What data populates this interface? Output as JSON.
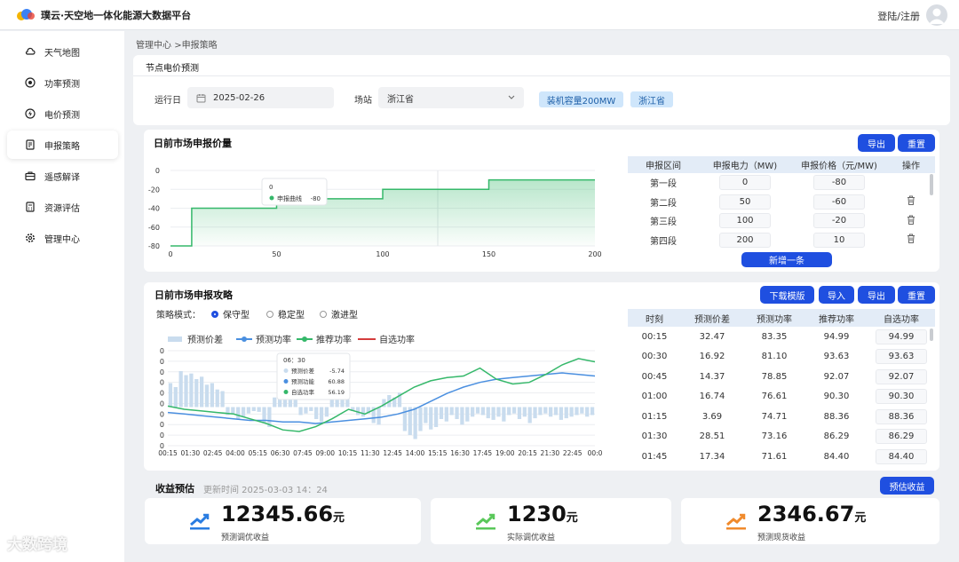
{
  "app": {
    "title": "璞云·天空地一体化能源大数据平台",
    "login": "登陆/注册"
  },
  "sidebar": {
    "items": [
      {
        "label": "天气地图",
        "icon": "cloud-sun-icon"
      },
      {
        "label": "功率预测",
        "icon": "target-icon"
      },
      {
        "label": "电价预测",
        "icon": "lightning-icon"
      },
      {
        "label": "申报策略",
        "icon": "document-icon"
      },
      {
        "label": "遥感解译",
        "icon": "briefcase-icon"
      },
      {
        "label": "资源评估",
        "icon": "calculator-icon"
      },
      {
        "label": "管理中心",
        "icon": "gear-icon"
      }
    ],
    "active": "申报策略"
  },
  "breadcrumb": {
    "root": "管理中心",
    "current": ">申报策略"
  },
  "section_title": "节点电价预测",
  "filters": {
    "date_label": "运行日",
    "date_value": "2025-02-26",
    "station_label": "场站",
    "station_value": "浙江省",
    "tags": [
      "装机容量200MW",
      "浙江省"
    ]
  },
  "bid_panel": {
    "title": "日前市场申报价量",
    "export": "导出",
    "reset": "重置",
    "columns": [
      "申报区间",
      "申报电力（MW)",
      "申报价格（元/MW)",
      "操作"
    ],
    "rows": [
      {
        "seg": "第一段",
        "power": "0",
        "price": "-80"
      },
      {
        "seg": "第二段",
        "power": "50",
        "price": "-60"
      },
      {
        "seg": "第三段",
        "power": "100",
        "price": "-20"
      },
      {
        "seg": "第四段",
        "power": "200",
        "price": "10"
      }
    ],
    "add_button": "新增一条",
    "tooltip": {
      "x": "0",
      "name": "申报曲线",
      "value": "-80"
    }
  },
  "strategy_panel": {
    "title": "日前市场申报攻略",
    "download": "下载模版",
    "import": "导入",
    "export": "导出",
    "reset": "重置",
    "mode_label": "策略模式：",
    "modes": [
      "保守型",
      "稳定型",
      "激进型"
    ],
    "selected_mode": "保守型",
    "legend": [
      "预测价差",
      "预测功率",
      "推荐功率",
      "自选功率"
    ],
    "tooltip": {
      "time": "06：30",
      "items": [
        {
          "name": "预测价差",
          "value": "-5.74"
        },
        {
          "name": "预测功能",
          "value": "60.88"
        },
        {
          "name": "自选功率",
          "value": "56.19"
        }
      ]
    },
    "columns": [
      "时刻",
      "预测价差",
      "预测功率",
      "推荐功率",
      "自选功率"
    ],
    "rows": [
      {
        "t": "00:15",
        "diff": "32.47",
        "pred": "83.35",
        "rec": "94.99",
        "self": "94.99"
      },
      {
        "t": "00:30",
        "diff": "16.92",
        "pred": "81.10",
        "rec": "93.63",
        "self": "93.63"
      },
      {
        "t": "00:45",
        "diff": "14.37",
        "pred": "78.85",
        "rec": "92.07",
        "self": "92.07"
      },
      {
        "t": "01:00",
        "diff": "16.74",
        "pred": "76.61",
        "rec": "90.30",
        "self": "90.30"
      },
      {
        "t": "01:15",
        "diff": "3.69",
        "pred": "74.71",
        "rec": "88.36",
        "self": "88.36"
      },
      {
        "t": "01:30",
        "diff": "28.51",
        "pred": "73.16",
        "rec": "86.29",
        "self": "86.29"
      },
      {
        "t": "01:45",
        "diff": "17.34",
        "pred": "71.61",
        "rec": "84.40",
        "self": "84.40"
      }
    ]
  },
  "revenue": {
    "title": "收益预估",
    "update": "更新时间 2025-03-03 14：24",
    "button": "预估收益",
    "kpis": [
      {
        "value": "12345.66",
        "unit": "元",
        "caption": "预测调优收益",
        "color": "#2a7de1"
      },
      {
        "value": "1230",
        "unit": "元",
        "caption": "实际调优收益",
        "color": "#5ac85a"
      },
      {
        "value": "2346.67",
        "unit": "元",
        "caption": "预测现货收益",
        "color": "#f08a2c"
      }
    ]
  },
  "watermark": "大数跨境",
  "chart_data": [
    {
      "type": "line",
      "title": "日前市场申报价量",
      "x": [
        0,
        10,
        50,
        100,
        150,
        200
      ],
      "y": [
        -80,
        -40,
        -30,
        -20,
        -10,
        -10
      ],
      "step": true,
      "ylim": [
        -80,
        0
      ],
      "xlim": [
        0,
        200
      ],
      "xticks": [
        0,
        50,
        100,
        150,
        200
      ],
      "yticks": [
        0,
        -20,
        -40,
        -60,
        -80
      ],
      "series_name": "申报曲线",
      "color": "#35b86a"
    },
    {
      "type": "line",
      "title": "日前市场申报攻略",
      "x": [
        "00:15",
        "01:30",
        "02:45",
        "04:00",
        "05:15",
        "06:30",
        "07:45",
        "09:00",
        "10:15",
        "11:30",
        "12:45",
        "14:00",
        "15:15",
        "16:30",
        "17:45",
        "19:00",
        "20:15",
        "21:30",
        "22:45",
        "00:0"
      ],
      "yticks": [
        "0",
        "0",
        "0",
        "0",
        "0",
        "0",
        "0",
        "0",
        "0",
        "0"
      ],
      "series": [
        {
          "name": "预测价差",
          "type": "bar",
          "color": "#c9dcee",
          "values": [
            30,
            25,
            45,
            40,
            42,
            35,
            38,
            28,
            30,
            22,
            20,
            -10,
            -8,
            -15,
            -12,
            -8,
            -5,
            -6,
            -20,
            -25,
            12,
            15,
            18,
            20,
            16,
            -10,
            -8,
            -5,
            -15,
            -18,
            -12,
            10,
            14,
            16,
            12,
            -5,
            -10,
            -12,
            -8,
            -20,
            -22,
            10,
            15,
            12,
            18,
            -30,
            -35,
            -40,
            -30,
            -20,
            -28,
            -25,
            -15,
            -18,
            -10,
            -15,
            -22,
            -18,
            -12,
            -8,
            -10,
            -14,
            -16,
            -12,
            -18,
            -10,
            -8,
            -15,
            -12,
            -20,
            -14,
            -10,
            -8,
            -12,
            -10,
            -16,
            -14,
            -12,
            -10,
            -8,
            -12,
            -10
          ]
        },
        {
          "name": "预测功率",
          "type": "line",
          "color": "#4a8fe0",
          "values": [
            56,
            55,
            54,
            53,
            52,
            51,
            51,
            50,
            50,
            49,
            50,
            51,
            52,
            53,
            55,
            58,
            63,
            68,
            72,
            75,
            77,
            78,
            79,
            80,
            81,
            80,
            79
          ]
        },
        {
          "name": "推荐功率",
          "type": "line",
          "color": "#35b86a",
          "values": [
            60,
            58,
            57,
            56,
            55,
            52,
            49,
            45,
            44,
            47,
            52,
            58,
            55,
            60,
            66,
            72,
            76,
            78,
            79,
            84,
            77,
            74,
            75,
            80,
            86,
            90,
            88
          ]
        },
        {
          "name": "自选功率",
          "type": "line",
          "color": "#d43c3c",
          "values": []
        }
      ]
    }
  ]
}
